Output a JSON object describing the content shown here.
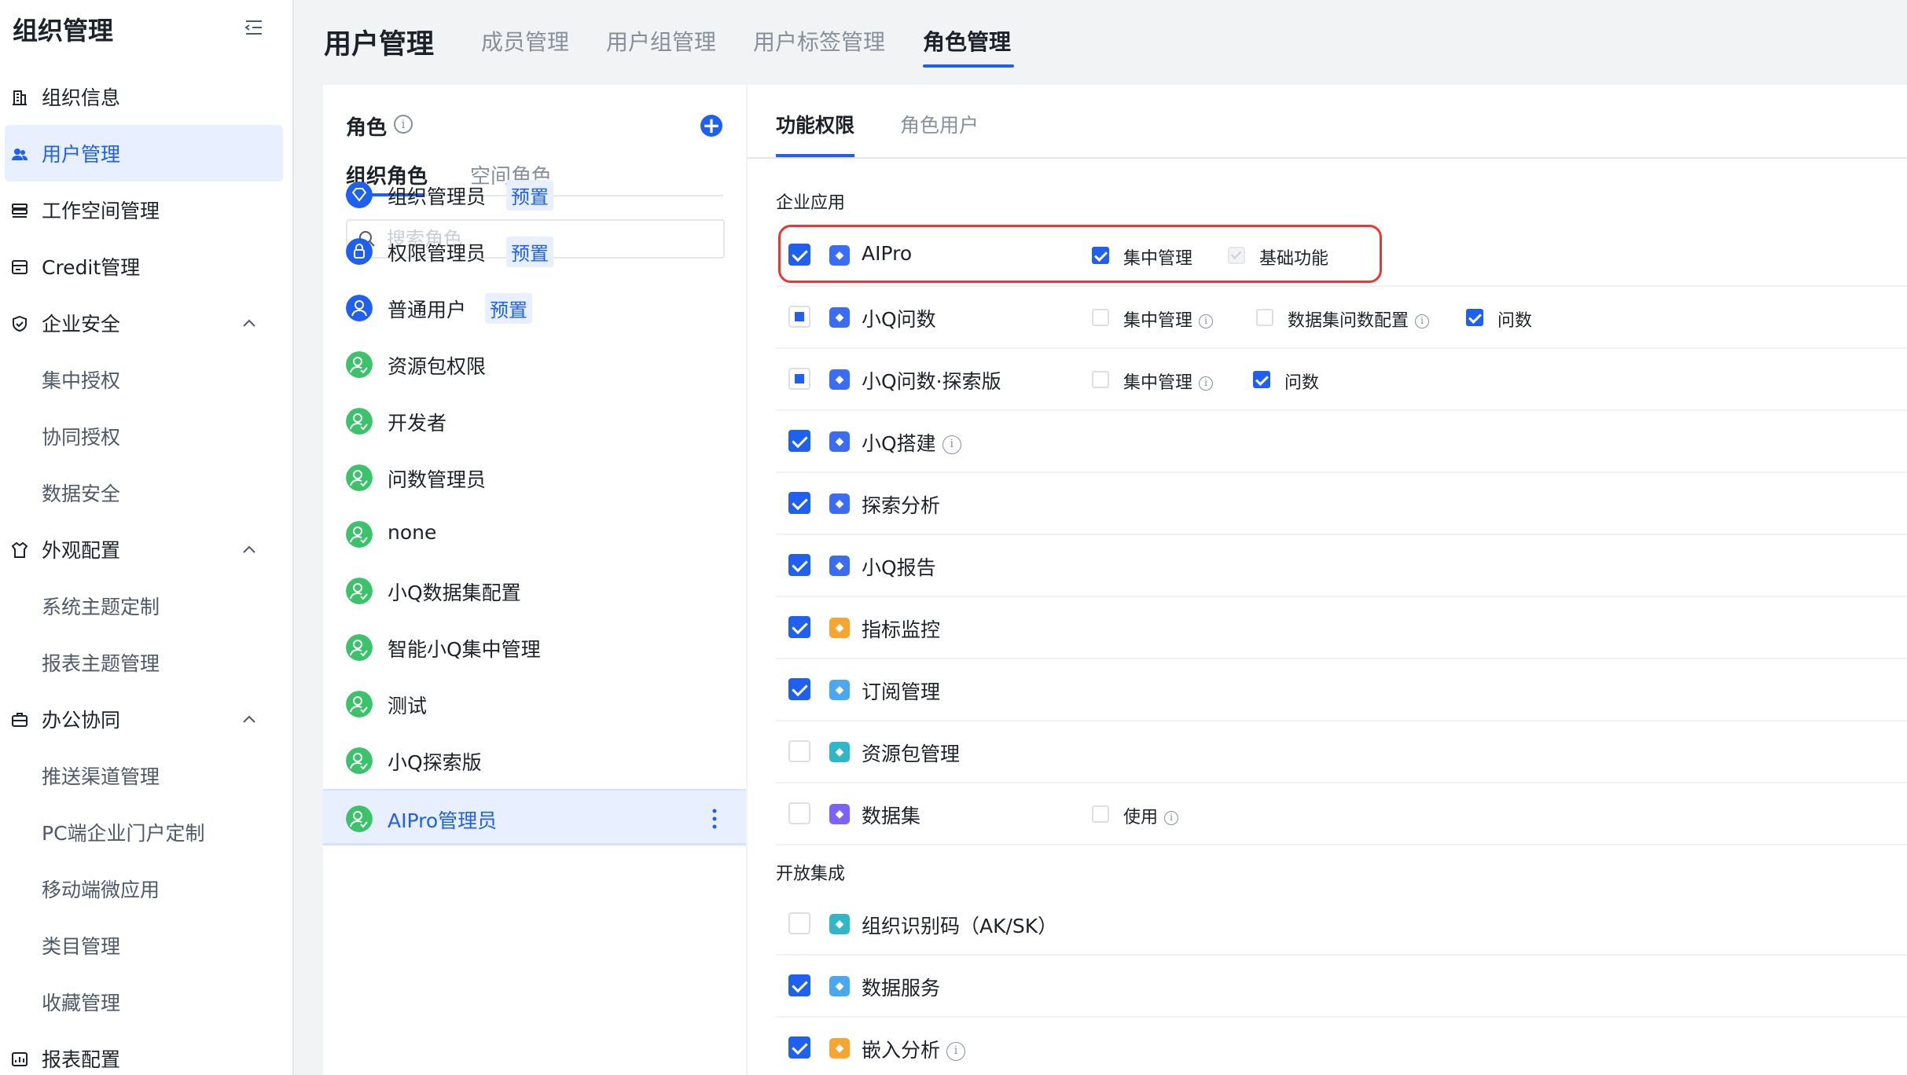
{
  "sidebar": {
    "title": "组织管理",
    "items": [
      {
        "label": "组织信息",
        "icon": "building-icon",
        "type": "top"
      },
      {
        "label": "用户管理",
        "icon": "users-icon",
        "type": "top",
        "active": true
      },
      {
        "label": "工作空间管理",
        "icon": "stack-icon",
        "type": "top"
      },
      {
        "label": "Credit管理",
        "icon": "credit-icon",
        "type": "top"
      },
      {
        "label": "企业安全",
        "icon": "shield-icon",
        "type": "group"
      },
      {
        "label": "集中授权",
        "type": "sub"
      },
      {
        "label": "协同授权",
        "type": "sub"
      },
      {
        "label": "数据安全",
        "type": "sub"
      },
      {
        "label": "外观配置",
        "icon": "shirt-icon",
        "type": "group"
      },
      {
        "label": "系统主题定制",
        "type": "sub"
      },
      {
        "label": "报表主题管理",
        "type": "sub"
      },
      {
        "label": "办公协同",
        "icon": "briefcase-icon",
        "type": "group"
      },
      {
        "label": "推送渠道管理",
        "type": "sub"
      },
      {
        "label": "PC端企业门户定制",
        "type": "sub"
      },
      {
        "label": "移动端微应用",
        "type": "sub"
      },
      {
        "label": "类目管理",
        "type": "sub"
      },
      {
        "label": "收藏管理",
        "type": "sub"
      },
      {
        "label": "报表配置",
        "icon": "report-icon",
        "type": "top"
      }
    ]
  },
  "topbar": {
    "title": "用户管理",
    "tabs": [
      "成员管理",
      "用户组管理",
      "用户标签管理",
      "角色管理"
    ],
    "active_tab": "角色管理"
  },
  "roles_panel": {
    "title": "角色",
    "tabs": [
      "组织角色",
      "空间角色"
    ],
    "search_placeholder": "搜索角色",
    "roles": [
      {
        "name": "组织管理员",
        "badge": "预置",
        "avatar": "diamond"
      },
      {
        "name": "权限管理员",
        "badge": "预置",
        "avatar": "lock"
      },
      {
        "name": "普通用户",
        "badge": "预置",
        "avatar": "user"
      },
      {
        "name": "资源包权限",
        "avatar": "green"
      },
      {
        "name": "开发者",
        "avatar": "green"
      },
      {
        "name": "问数管理员",
        "avatar": "green"
      },
      {
        "name": "none",
        "avatar": "green"
      },
      {
        "name": "小Q数据集配置",
        "avatar": "green"
      },
      {
        "name": "智能小Q集中管理",
        "avatar": "green"
      },
      {
        "name": "测试",
        "avatar": "green"
      },
      {
        "name": "小Q探索版",
        "avatar": "green"
      },
      {
        "name": "AIPro管理员",
        "avatar": "green",
        "selected": true
      }
    ]
  },
  "perm_panel": {
    "tabs": [
      "功能权限",
      "角色用户"
    ],
    "sections": [
      {
        "title": "企业应用",
        "rows": [
          {
            "name": "AIPro",
            "state": "on",
            "icon": "aipro-icon",
            "color": "#3b6cf5",
            "options": [
              {
                "label": "集中管理",
                "state": "on"
              },
              {
                "label": "基础功能",
                "state": "disabled"
              }
            ]
          },
          {
            "name": "小Q问数",
            "state": "partial",
            "icon": "chat-icon",
            "color": "#3b6cf5",
            "options": [
              {
                "label": "集中管理",
                "state": "off",
                "info": true
              },
              {
                "label": "数据集问数配置",
                "state": "off",
                "info": true
              },
              {
                "label": "问数",
                "state": "on"
              }
            ]
          },
          {
            "name": "小Q问数·探索版",
            "state": "partial",
            "icon": "explore-chat-icon",
            "color": "#3b6cf5",
            "options": [
              {
                "label": "集中管理",
                "state": "off",
                "info": true
              },
              {
                "label": "问数",
                "state": "on"
              }
            ]
          },
          {
            "name": "小Q搭建",
            "state": "on",
            "icon": "build-icon",
            "color": "#3b6cf5",
            "info": true,
            "options": []
          },
          {
            "name": "探索分析",
            "state": "on",
            "icon": "analysis-icon",
            "color": "#3b6cf5",
            "options": []
          },
          {
            "name": "小Q报告",
            "state": "on",
            "icon": "report-doc-icon",
            "color": "#3b6cf5",
            "options": []
          },
          {
            "name": "指标监控",
            "state": "on",
            "icon": "monitor-icon",
            "color": "#f7a531",
            "options": []
          },
          {
            "name": "订阅管理",
            "state": "on",
            "icon": "bookmark-icon",
            "color": "#4aa8f0",
            "options": []
          },
          {
            "name": "资源包管理",
            "state": "off",
            "icon": "package-icon",
            "color": "#2fb7c9",
            "options": []
          },
          {
            "name": "数据集",
            "state": "off",
            "icon": "dataset-icon",
            "color": "#7b61ff",
            "options": [
              {
                "label": "使用",
                "state": "off",
                "info": true
              }
            ]
          }
        ]
      },
      {
        "title": "开放集成",
        "rows": [
          {
            "name": "组织识别码（AK/SK）",
            "state": "off",
            "icon": "scan-icon",
            "color": "#2fb7c9",
            "options": []
          },
          {
            "name": "数据服务",
            "state": "on",
            "icon": "api-icon",
            "color": "#4aa8f0",
            "options": []
          },
          {
            "name": "嵌入分析",
            "state": "on",
            "icon": "embed-icon",
            "color": "#f7a531",
            "info": true,
            "options": []
          }
        ]
      }
    ]
  },
  "colors": {
    "accent": "#1f5ff2",
    "highlight": "#e53935",
    "role_green": "#3cc26b"
  }
}
